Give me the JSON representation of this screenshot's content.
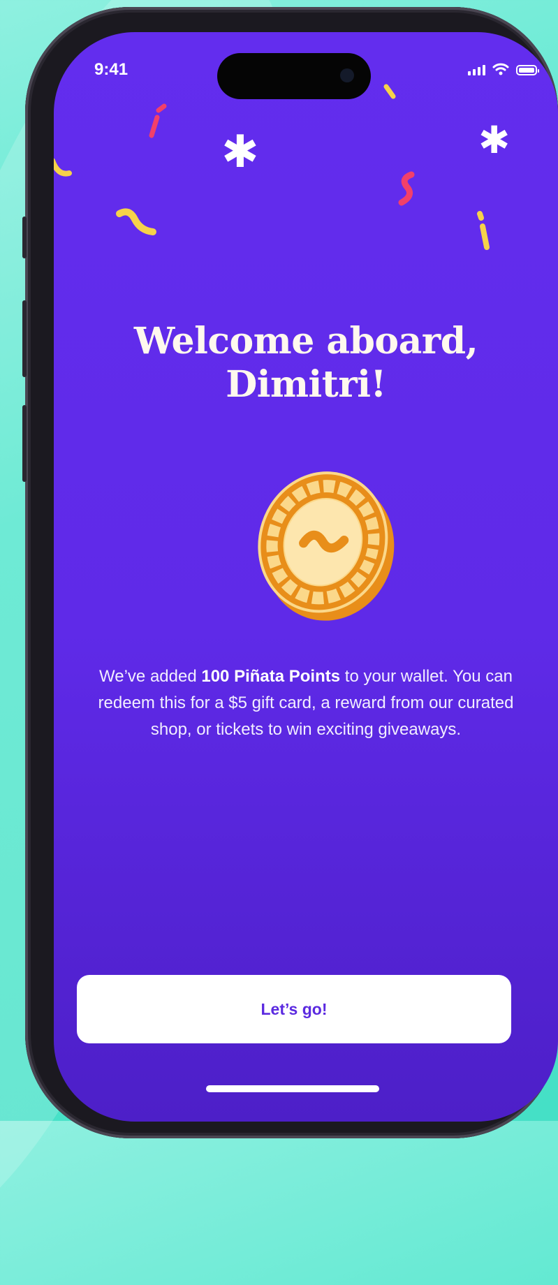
{
  "status_bar": {
    "time": "9:41"
  },
  "onboarding": {
    "title_line1": "Welcome aboard,",
    "title_line2": "Dimitri!",
    "description_prefix": "We’ve added ",
    "description_points": "100 Piñata Points",
    "description_suffix": " to your wallet. You can redeem this for a $5 gift card, a reward from our curated shop, or tickets to win exciting giveaways.",
    "cta_label": "Let’s go!"
  },
  "confetti": {
    "asterisk_glyph": "✱"
  },
  "colors": {
    "screen_bg": "#632dee",
    "background_teal": "#45e0c6",
    "confetti_pink": "#f2406a",
    "confetti_yellow": "#f6d24a",
    "coin_gold": "#f6a623",
    "button_text": "#5b2ae0"
  }
}
